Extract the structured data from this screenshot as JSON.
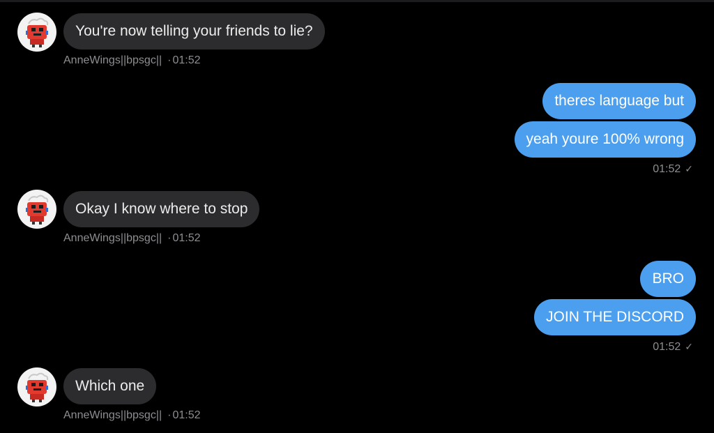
{
  "contact": {
    "name": "AnneWings||bpsgc||",
    "avatar_icon": "red-robot-avatar-icon"
  },
  "colors": {
    "background": "#000000",
    "incoming_bubble": "#2c2c2e",
    "outgoing_bubble": "#4c9fef",
    "meta_text": "#8e8e93"
  },
  "messages": [
    {
      "direction": "incoming",
      "text": "You're now telling your friends to lie?",
      "sender": "AnneWings||bpsgc||",
      "separator": "·",
      "time": "01:52"
    },
    {
      "direction": "outgoing",
      "texts": [
        "theres language but",
        "yeah youre 100% wrong"
      ],
      "time": "01:52",
      "status_icon": "checkmark-icon"
    },
    {
      "direction": "incoming",
      "text": "Okay I know where to stop",
      "sender": "AnneWings||bpsgc||",
      "separator": "·",
      "time": "01:52"
    },
    {
      "direction": "outgoing",
      "texts": [
        "BRO",
        "JOIN THE DISCORD"
      ],
      "time": "01:52",
      "status_icon": "checkmark-icon"
    },
    {
      "direction": "incoming",
      "text": "Which one",
      "sender": "AnneWings||bpsgc||",
      "separator": "·",
      "time": "01:52"
    }
  ],
  "check_glyph": "✓"
}
